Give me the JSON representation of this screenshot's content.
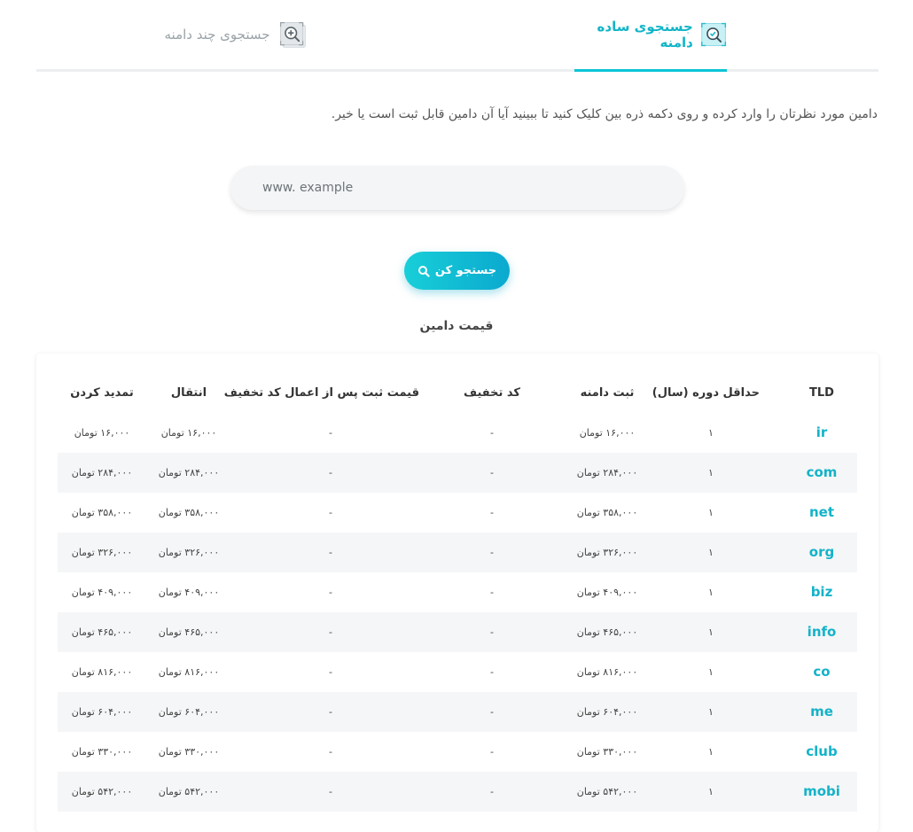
{
  "tabs": {
    "simple": {
      "label": "جستجوی ساده دامنه",
      "icon": "search-check-icon"
    },
    "multi": {
      "label": "جستجوی چند دامنه",
      "icon": "search-plus-icon"
    }
  },
  "intro": "دامین مورد نظرتان را وارد کرده و روی دکمه ذره بین کلیک کنید تا ببینید آیا آن دامین قابل ثبت است یا خیر.",
  "search": {
    "placeholder": "www. example",
    "value": ""
  },
  "search_button": {
    "label": "جستجو کن",
    "icon": "search-icon"
  },
  "section_title": "قیمت دامین",
  "colors": {
    "accent": "#0bc4d6",
    "tld": "#14b3c9",
    "row_alt": "#f5f6f7"
  },
  "table": {
    "headers": {
      "tld": "TLD",
      "min_period": "حداقل دوره (سال)",
      "register": "ثبت دامنه",
      "discount_code": "کد تخفیف",
      "after_discount": "قیمت ثبت پس از اعمال کد تخفیف",
      "transfer": "انتقال",
      "renew": "تمدید کردن"
    },
    "rows": [
      {
        "tld": "ir",
        "min": "۱",
        "register": "۱۶,۰۰۰ تومان",
        "discount": "-",
        "after": "-",
        "transfer": "۱۶,۰۰۰ تومان",
        "renew": "۱۶,۰۰۰ تومان"
      },
      {
        "tld": "com",
        "min": "۱",
        "register": "۲۸۴,۰۰۰ تومان",
        "discount": "-",
        "after": "-",
        "transfer": "۲۸۴,۰۰۰ تومان",
        "renew": "۲۸۴,۰۰۰ تومان"
      },
      {
        "tld": "net",
        "min": "۱",
        "register": "۳۵۸,۰۰۰ تومان",
        "discount": "-",
        "after": "-",
        "transfer": "۳۵۸,۰۰۰ تومان",
        "renew": "۳۵۸,۰۰۰ تومان"
      },
      {
        "tld": "org",
        "min": "۱",
        "register": "۳۲۶,۰۰۰ تومان",
        "discount": "-",
        "after": "-",
        "transfer": "۳۲۶,۰۰۰ تومان",
        "renew": "۳۲۶,۰۰۰ تومان"
      },
      {
        "tld": "biz",
        "min": "۱",
        "register": "۴۰۹,۰۰۰ تومان",
        "discount": "-",
        "after": "-",
        "transfer": "۴۰۹,۰۰۰ تومان",
        "renew": "۴۰۹,۰۰۰ تومان"
      },
      {
        "tld": "info",
        "min": "۱",
        "register": "۴۶۵,۰۰۰ تومان",
        "discount": "-",
        "after": "-",
        "transfer": "۴۶۵,۰۰۰ تومان",
        "renew": "۴۶۵,۰۰۰ تومان"
      },
      {
        "tld": "co",
        "min": "۱",
        "register": "۸۱۶,۰۰۰ تومان",
        "discount": "-",
        "after": "-",
        "transfer": "۸۱۶,۰۰۰ تومان",
        "renew": "۸۱۶,۰۰۰ تومان"
      },
      {
        "tld": "me",
        "min": "۱",
        "register": "۶۰۴,۰۰۰ تومان",
        "discount": "-",
        "after": "-",
        "transfer": "۶۰۴,۰۰۰ تومان",
        "renew": "۶۰۴,۰۰۰ تومان"
      },
      {
        "tld": "club",
        "min": "۱",
        "register": "۳۳۰,۰۰۰ تومان",
        "discount": "-",
        "after": "-",
        "transfer": "۳۳۰,۰۰۰ تومان",
        "renew": "۳۳۰,۰۰۰ تومان"
      },
      {
        "tld": "mobi",
        "min": "۱",
        "register": "۵۴۲,۰۰۰ تومان",
        "discount": "-",
        "after": "-",
        "transfer": "۵۴۲,۰۰۰ تومان",
        "renew": "۵۴۲,۰۰۰ تومان"
      }
    ]
  }
}
